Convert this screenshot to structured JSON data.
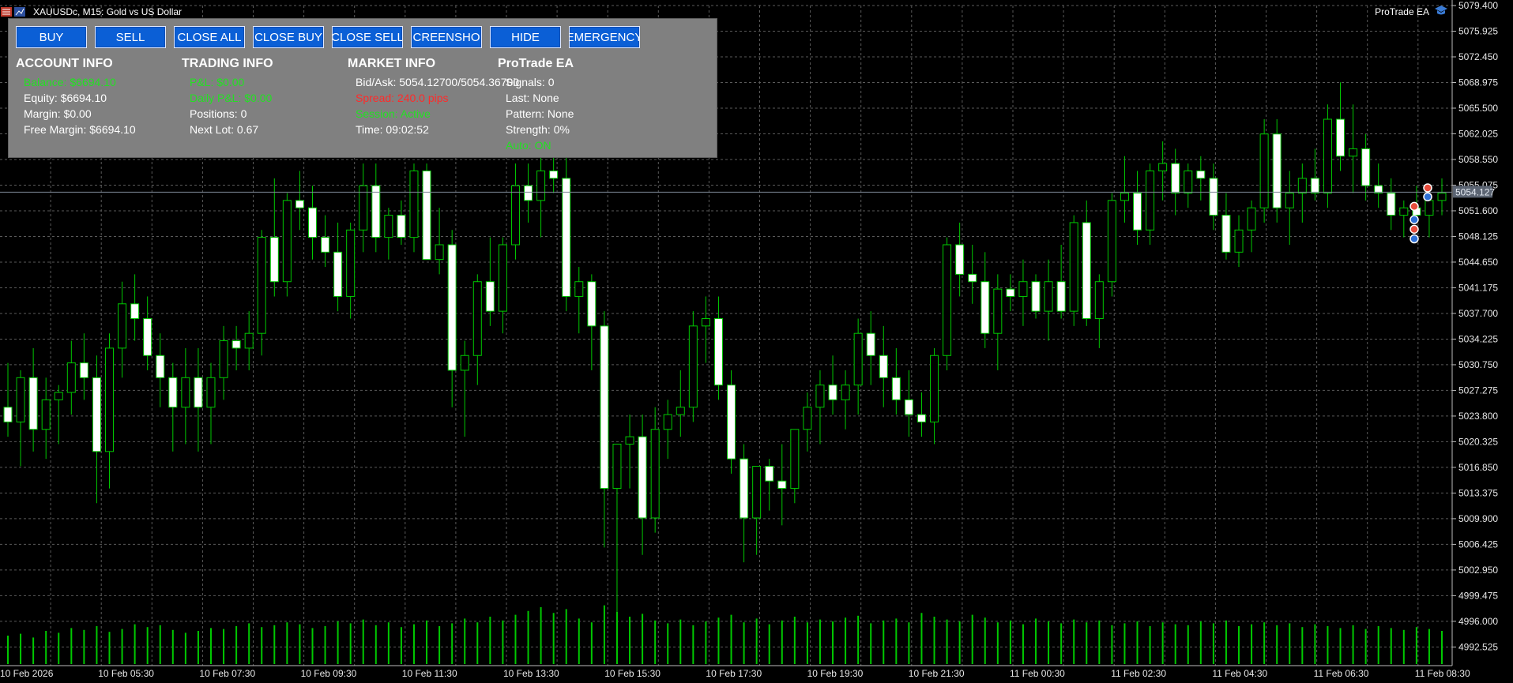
{
  "window": {
    "symbol_title": "XAUUSDc, M15:  Gold vs US Dollar",
    "ea_name": "ProTrade EA"
  },
  "panel": {
    "buttons": [
      "BUY",
      "SELL",
      "CLOSE ALL",
      "CLOSE BUY",
      "CLOSE SELL",
      "CREENSHO",
      "HIDE",
      "EMERGENCY"
    ],
    "account": {
      "header": "ACCOUNT INFO",
      "balance": "Balance: $6694.10",
      "equity": "Equity: $6694.10",
      "margin": "Margin: $0.00",
      "free_margin": "Free Margin: $6694.10"
    },
    "trading": {
      "header": "TRADING INFO",
      "pnl": "P&L: $0.00",
      "daily_pnl": "Daily P&L: $0.00",
      "positions": "Positions: 0",
      "next_lot": "Next Lot: 0.67"
    },
    "market": {
      "header": "MARKET INFO",
      "bid_ask": "Bid/Ask: 5054.12700/5054.36700",
      "spread": "Spread: 240.0 pips",
      "session": "Session: Active",
      "time": "Time: 09:02:52"
    },
    "ea": {
      "header": "ProTrade EA",
      "signals": "Signals: 0",
      "last": "Last: None",
      "pattern": "Pattern: None",
      "strength": "Strength: 0%",
      "auto": "Auto: ON"
    }
  },
  "colors": {
    "background": "#000000",
    "grid": "#5a5a5a",
    "bull_candle": "#000000",
    "bear_candle": "#ffffff",
    "wick": "#00c800",
    "volume": "#00c800",
    "panel": "#808080",
    "button": "#0b5fd6",
    "positive_text": "#23e023",
    "negative_text": "#ff2a2a"
  },
  "chart_data": {
    "type": "candlestick",
    "timeframe": "M15",
    "ylim": [
      4990.0,
      5079.4
    ],
    "y_ticks": [
      "5079.400",
      "5075.925",
      "5072.450",
      "5068.975",
      "5065.500",
      "5062.025",
      "5058.550",
      "5055.075",
      "5051.600",
      "5048.125",
      "5044.650",
      "5041.175",
      "5037.700",
      "5034.225",
      "5030.750",
      "5027.275",
      "5023.800",
      "5020.325",
      "5016.850",
      "5013.375",
      "5009.900",
      "5006.425",
      "5002.950",
      "4999.475",
      "4996.000",
      "4992.525"
    ],
    "x_ticks": [
      "10 Feb 2026",
      "10 Feb 05:30",
      "10 Feb 07:30",
      "10 Feb 09:30",
      "10 Feb 11:30",
      "10 Feb 13:30",
      "10 Feb 15:30",
      "10 Feb 17:30",
      "10 Feb 19:30",
      "10 Feb 21:30",
      "11 Feb 00:30",
      "11 Feb 02:30",
      "11 Feb 04:30",
      "11 Feb 06:30",
      "11 Feb 08:30"
    ],
    "current_price": "5054.127",
    "candles": [
      [
        5025.0,
        5031.0,
        5021.0,
        5023.0
      ],
      [
        5023.0,
        5030.0,
        5017.0,
        5029.0
      ],
      [
        5029.0,
        5033.0,
        5019.0,
        5022.0
      ],
      [
        5022.0,
        5029.0,
        5018.0,
        5026.0
      ],
      [
        5026.0,
        5028.0,
        5020.0,
        5027.0
      ],
      [
        5027.0,
        5034.0,
        5024.0,
        5031.0
      ],
      [
        5031.0,
        5035.0,
        5026.0,
        5029.0
      ],
      [
        5029.0,
        5032.0,
        5012.0,
        5019.0
      ],
      [
        5019.0,
        5035.0,
        5014.0,
        5033.0
      ],
      [
        5033.0,
        5042.0,
        5029.0,
        5039.0
      ],
      [
        5039.0,
        5043.0,
        5034.0,
        5037.0
      ],
      [
        5037.0,
        5040.0,
        5030.0,
        5032.0
      ],
      [
        5032.0,
        5035.0,
        5025.0,
        5029.0
      ],
      [
        5029.0,
        5031.0,
        5019.0,
        5025.0
      ],
      [
        5025.0,
        5033.0,
        5020.0,
        5029.0
      ],
      [
        5029.0,
        5033.0,
        5019.0,
        5025.0
      ],
      [
        5025.0,
        5031.0,
        5020.0,
        5029.0
      ],
      [
        5029.0,
        5036.0,
        5026.0,
        5034.0
      ],
      [
        5034.0,
        5036.0,
        5030.0,
        5033.0
      ],
      [
        5033.0,
        5038.0,
        5030.0,
        5035.0
      ],
      [
        5035.0,
        5049.0,
        5032.0,
        5048.0
      ],
      [
        5048.0,
        5056.0,
        5040.0,
        5042.0
      ],
      [
        5042.0,
        5054.0,
        5040.0,
        5053.0
      ],
      [
        5053.0,
        5057.0,
        5049.0,
        5052.0
      ],
      [
        5052.0,
        5055.0,
        5045.0,
        5048.0
      ],
      [
        5048.0,
        5051.0,
        5044.0,
        5046.0
      ],
      [
        5046.0,
        5050.0,
        5038.0,
        5040.0
      ],
      [
        5040.0,
        5050.0,
        5037.0,
        5049.0
      ],
      [
        5049.0,
        5058.0,
        5046.0,
        5055.0
      ],
      [
        5055.0,
        5058.0,
        5046.0,
        5048.0
      ],
      [
        5048.0,
        5052.0,
        5045.0,
        5051.0
      ],
      [
        5051.0,
        5053.0,
        5047.0,
        5048.0
      ],
      [
        5048.0,
        5058.0,
        5046.0,
        5057.0
      ],
      [
        5057.0,
        5058.0,
        5045.0,
        5045.0
      ],
      [
        5045.0,
        5052.0,
        5043.0,
        5047.0
      ],
      [
        5047.0,
        5049.0,
        5025.0,
        5030.0
      ],
      [
        5030.0,
        5034.0,
        5021.0,
        5032.0
      ],
      [
        5032.0,
        5043.0,
        5028.0,
        5042.0
      ],
      [
        5042.0,
        5048.0,
        5036.0,
        5038.0
      ],
      [
        5038.0,
        5048.0,
        5035.0,
        5047.0
      ],
      [
        5047.0,
        5058.0,
        5045.0,
        5055.0
      ],
      [
        5055.0,
        5058.0,
        5050.0,
        5053.0
      ],
      [
        5053.0,
        5060.0,
        5048.0,
        5057.0
      ],
      [
        5057.0,
        5061.0,
        5054.0,
        5056.0
      ],
      [
        5056.0,
        5059.0,
        5038.0,
        5040.0
      ],
      [
        5040.0,
        5044.0,
        5035.0,
        5042.0
      ],
      [
        5042.0,
        5043.0,
        5030.0,
        5036.0
      ],
      [
        5036.0,
        5038.0,
        5006.0,
        5014.0
      ],
      [
        5014.0,
        5020.0,
        4997.0,
        5020.0
      ],
      [
        5020.0,
        5024.0,
        5014.0,
        5021.0
      ],
      [
        5021.0,
        5024.0,
        5005.0,
        5010.0
      ],
      [
        5010.0,
        5025.0,
        5008.0,
        5022.0
      ],
      [
        5022.0,
        5026.0,
        5018.0,
        5024.0
      ],
      [
        5024.0,
        5030.0,
        5021.0,
        5025.0
      ],
      [
        5025.0,
        5038.0,
        5023.0,
        5036.0
      ],
      [
        5036.0,
        5040.0,
        5031.0,
        5037.0
      ],
      [
        5037.0,
        5040.0,
        5026.0,
        5028.0
      ],
      [
        5028.0,
        5030.0,
        5016.0,
        5018.0
      ],
      [
        5018.0,
        5020.0,
        5004.0,
        5010.0
      ],
      [
        5010.0,
        5017.0,
        5005.0,
        5017.0
      ],
      [
        5017.0,
        5018.0,
        5011.0,
        5015.0
      ],
      [
        5015.0,
        5020.0,
        5009.0,
        5014.0
      ],
      [
        5014.0,
        5022.0,
        5012.0,
        5022.0
      ],
      [
        5022.0,
        5027.0,
        5019.0,
        5025.0
      ],
      [
        5025.0,
        5030.0,
        5020.0,
        5028.0
      ],
      [
        5028.0,
        5032.0,
        5024.0,
        5026.0
      ],
      [
        5026.0,
        5030.0,
        5022.0,
        5028.0
      ],
      [
        5028.0,
        5037.0,
        5024.0,
        5035.0
      ],
      [
        5035.0,
        5038.0,
        5028.0,
        5032.0
      ],
      [
        5032.0,
        5036.0,
        5025.0,
        5029.0
      ],
      [
        5029.0,
        5033.0,
        5024.0,
        5026.0
      ],
      [
        5026.0,
        5030.0,
        5021.0,
        5024.0
      ],
      [
        5024.0,
        5027.0,
        5021.0,
        5023.0
      ],
      [
        5023.0,
        5033.0,
        5020.0,
        5032.0
      ],
      [
        5032.0,
        5048.0,
        5030.0,
        5047.0
      ],
      [
        5047.0,
        5050.0,
        5040.0,
        5043.0
      ],
      [
        5043.0,
        5047.0,
        5039.0,
        5042.0
      ],
      [
        5042.0,
        5046.0,
        5033.0,
        5035.0
      ],
      [
        5035.0,
        5043.0,
        5030.0,
        5041.0
      ],
      [
        5041.0,
        5043.0,
        5038.0,
        5040.0
      ],
      [
        5040.0,
        5045.0,
        5036.0,
        5042.0
      ],
      [
        5042.0,
        5043.0,
        5037.0,
        5038.0
      ],
      [
        5038.0,
        5045.0,
        5034.0,
        5042.0
      ],
      [
        5042.0,
        5047.0,
        5037.0,
        5038.0
      ],
      [
        5038.0,
        5051.0,
        5036.0,
        5050.0
      ],
      [
        5050.0,
        5053.0,
        5036.0,
        5037.0
      ],
      [
        5037.0,
        5043.0,
        5033.0,
        5042.0
      ],
      [
        5042.0,
        5054.0,
        5040.0,
        5053.0
      ],
      [
        5053.0,
        5059.0,
        5050.0,
        5054.0
      ],
      [
        5054.0,
        5057.0,
        5047.0,
        5049.0
      ],
      [
        5049.0,
        5058.0,
        5047.0,
        5057.0
      ],
      [
        5057.0,
        5061.0,
        5053.0,
        5058.0
      ],
      [
        5058.0,
        5060.0,
        5051.0,
        5054.0
      ],
      [
        5054.0,
        5058.0,
        5052.0,
        5057.0
      ],
      [
        5057.0,
        5059.0,
        5053.0,
        5056.0
      ],
      [
        5056.0,
        5058.0,
        5049.0,
        5051.0
      ],
      [
        5051.0,
        5054.0,
        5045.0,
        5046.0
      ],
      [
        5046.0,
        5051.0,
        5044.0,
        5049.0
      ],
      [
        5049.0,
        5053.0,
        5046.0,
        5052.0
      ],
      [
        5052.0,
        5064.0,
        5050.0,
        5062.0
      ],
      [
        5062.0,
        5064.0,
        5050.0,
        5052.0
      ],
      [
        5052.0,
        5057.0,
        5047.0,
        5054.0
      ],
      [
        5054.0,
        5058.0,
        5050.0,
        5056.0
      ],
      [
        5056.0,
        5060.0,
        5053.0,
        5054.0
      ],
      [
        5054.0,
        5066.0,
        5052.0,
        5064.0
      ],
      [
        5064.0,
        5069.0,
        5057.0,
        5059.0
      ],
      [
        5059.0,
        5066.0,
        5054.0,
        5060.0
      ],
      [
        5060.0,
        5062.0,
        5053.0,
        5055.0
      ],
      [
        5055.0,
        5058.0,
        5052.0,
        5054.0
      ],
      [
        5054.0,
        5056.0,
        5049.0,
        5051.0
      ],
      [
        5051.0,
        5053.0,
        5048.0,
        5052.0
      ],
      [
        5052.0,
        5055.0,
        5050.0,
        5051.0
      ],
      [
        5051.0,
        5054.0,
        5048.0,
        5053.0
      ],
      [
        5053.0,
        5056.0,
        5051.0,
        5054.0
      ]
    ],
    "volumes": [
      30,
      32,
      28,
      35,
      33,
      38,
      36,
      40,
      34,
      37,
      42,
      39,
      41,
      36,
      33,
      35,
      38,
      37,
      40,
      43,
      39,
      41,
      44,
      42,
      38,
      40,
      45,
      43,
      47,
      41,
      44,
      39,
      42,
      46,
      40,
      43,
      48,
      44,
      50,
      46,
      52,
      56,
      60,
      54,
      58,
      48,
      44,
      62,
      55,
      50,
      53,
      46,
      43,
      47,
      41,
      45,
      49,
      52,
      44,
      48,
      42,
      46,
      50,
      44,
      47,
      45,
      49,
      51,
      43,
      46,
      48,
      44,
      54,
      50,
      47,
      45,
      52,
      49,
      44,
      46,
      42,
      48,
      45,
      43,
      47,
      44,
      46,
      41,
      43,
      45,
      40,
      44,
      42,
      41,
      45,
      43,
      46,
      40,
      42,
      44,
      41,
      43,
      39,
      42,
      40,
      38,
      41,
      37,
      40,
      38,
      36,
      39,
      37,
      35
    ]
  }
}
